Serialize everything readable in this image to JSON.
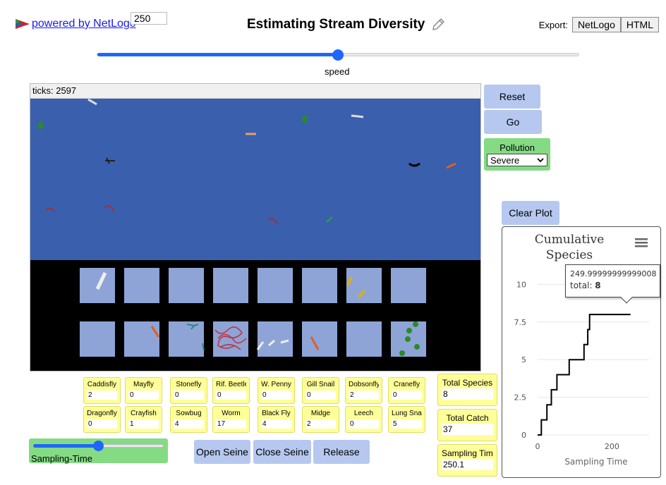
{
  "header": {
    "powered_by": "powered by NetLogo",
    "title": "Estimating Stream Diversity",
    "export_label": "Export:",
    "export_buttons": [
      "NetLogo",
      "HTML"
    ]
  },
  "speed_slider": {
    "label": "speed",
    "value_fraction": 0.5
  },
  "view": {
    "ticks_label": "ticks: 2597"
  },
  "buttons": {
    "reset": "Reset",
    "go": "Go",
    "clear_plot": "Clear Plot",
    "open_seine": "Open Seine",
    "close_seine": "Close Seine",
    "release": "Release"
  },
  "pollution": {
    "label": "Pollution",
    "selected": "Severe"
  },
  "monitors": [
    {
      "label": "Caddisfly",
      "value": "2"
    },
    {
      "label": "Mayfly",
      "value": "0"
    },
    {
      "label": "Stonefly",
      "value": "0"
    },
    {
      "label": "Rif. Beetle",
      "value": "0"
    },
    {
      "label": "W. Penny",
      "value": "0"
    },
    {
      "label": "Gill Snail",
      "value": "0"
    },
    {
      "label": "Dobsonfly",
      "value": "2"
    },
    {
      "label": "Cranefly",
      "value": "0"
    },
    {
      "label": "Dragonfly",
      "value": "0"
    },
    {
      "label": "Crayfish",
      "value": "1"
    },
    {
      "label": "Sowbug",
      "value": "4"
    },
    {
      "label": "Worm",
      "value": "17"
    },
    {
      "label": "Black Fly",
      "value": "4"
    },
    {
      "label": "Midge",
      "value": "2"
    },
    {
      "label": "Leech",
      "value": "0"
    },
    {
      "label": "Lung Snail",
      "value": "5"
    }
  ],
  "summary_monitors": {
    "total_species": {
      "label": "Total Species",
      "value": "8"
    },
    "total_catch": {
      "label": "Total Catch",
      "value": "37"
    },
    "sampling_time": {
      "label": "Sampling Time",
      "value": "250.1"
    }
  },
  "sampling_slider": {
    "label": "Sampling-Time",
    "value": "250",
    "value_fraction": 0.5
  },
  "plot": {
    "title_line1": "Cumulative",
    "title_line2": "Species",
    "tooltip_x": "249.99999999999008",
    "tooltip_series": "total: ",
    "tooltip_value": "8"
  },
  "chart_data": {
    "type": "line",
    "title": "Cumulative Species",
    "xlabel": "Sampling Time",
    "ylabel": "",
    "xlim": [
      0,
      300
    ],
    "ylim": [
      0,
      11
    ],
    "xticks": [
      "0",
      "200"
    ],
    "yticks": [
      "0",
      "2.5",
      "5",
      "7.5",
      "10"
    ],
    "grid": true,
    "series": [
      {
        "name": "total",
        "color": "#000000",
        "step": true,
        "points": [
          [
            0,
            0
          ],
          [
            10,
            0
          ],
          [
            10,
            1
          ],
          [
            25,
            1
          ],
          [
            25,
            2
          ],
          [
            37,
            2
          ],
          [
            37,
            3
          ],
          [
            52,
            3
          ],
          [
            52,
            4
          ],
          [
            85,
            4
          ],
          [
            85,
            5
          ],
          [
            125,
            5
          ],
          [
            125,
            6
          ],
          [
            135,
            6
          ],
          [
            135,
            7
          ],
          [
            140,
            7
          ],
          [
            140,
            8
          ],
          [
            250,
            8
          ]
        ]
      }
    ]
  }
}
